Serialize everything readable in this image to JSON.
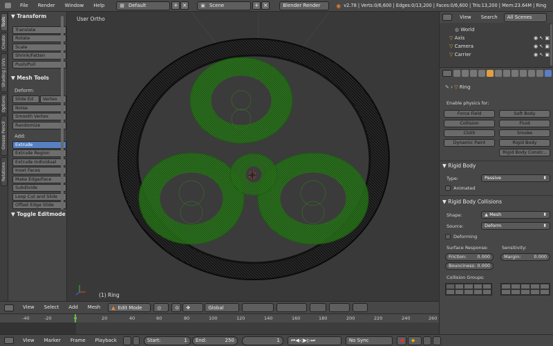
{
  "topbar": {
    "menus": [
      "File",
      "Render",
      "Window",
      "Help"
    ],
    "layout": "Default",
    "scene": "Scene",
    "engine": "Blender Render",
    "stats": "v2.78 | Verts:0/6,600 | Edges:0/13,200 | Faces:0/6,600 | Tris:13,200 | Mem:23.64M | Ring"
  },
  "tabs": [
    "Tools",
    "Create",
    "Shading / UVs",
    "Options",
    "Grease Pencil",
    "Relations"
  ],
  "shelf": {
    "transform_header": "Transform",
    "transform": [
      "Translate",
      "Rotate",
      "Scale",
      "Shrink/Fatten",
      "Push/Pull"
    ],
    "mesh_tools_header": "Mesh Tools",
    "deform_label": "Deform:",
    "slide_edge": "Slide Ed",
    "vertex": "Vertex",
    "deform": [
      "Noise",
      "Smooth Vertex",
      "Randomize"
    ],
    "add_label": "Add:",
    "add": [
      "Extrude",
      "Extrude Region",
      "Extrude Individual",
      "Inset Faces",
      "Make Edge/Face",
      "Subdivide",
      "Loop Cut and Slide",
      "Offset Edge Slide"
    ],
    "toggle_header": "Toggle Editmode"
  },
  "viewport": {
    "title": "User Ortho",
    "object": "(1) Ring"
  },
  "vpheader": {
    "menus": [
      "View",
      "Select",
      "Add",
      "Mesh"
    ],
    "mode": "Edit Mode",
    "orientation": "Global"
  },
  "timeline": {
    "ticks": [
      "-40",
      "-20",
      "0",
      "20",
      "40",
      "60",
      "80",
      "100",
      "120",
      "140",
      "160",
      "180",
      "200",
      "220",
      "240",
      "260"
    ],
    "menus": [
      "View",
      "Marker",
      "Frame",
      "Playback"
    ],
    "start_label": "Start:",
    "start_value": "1",
    "end_label": "End:",
    "end_value": "250",
    "current": "1",
    "sync": "No Sync"
  },
  "outliner": {
    "menus": [
      "View",
      "Search"
    ],
    "filter": "All Scenes",
    "items": [
      "World",
      "Axis",
      "Camera",
      "Carrier"
    ]
  },
  "properties": {
    "object": "Ring",
    "enable_label": "Enable physics for:",
    "physics": [
      "Force Field",
      "Soft Body",
      "Collision",
      "Fluid",
      "Cloth",
      "Smoke",
      "Dynamic Paint",
      "Rigid Body",
      "Rigid Body Constr..."
    ],
    "rigid_body_header": "Rigid Body",
    "type_label": "Type:",
    "type_value": "Passive",
    "animated_label": "Animated",
    "collisions_header": "Rigid Body Collisions",
    "shape_label": "Shape:",
    "shape_value": "Mesh",
    "source_label": "Source:",
    "source_value": "Deform",
    "deforming_label": "Deforming",
    "surface_label": "Surface Response:",
    "sensitivity_label": "Sensitivity:",
    "friction_label": "Friction:",
    "friction_value": "0.000",
    "margin_label": "Margin:",
    "margin_value": "0.000",
    "bounciness_label": "Bounciness:",
    "bounciness_value": "0.000",
    "groups_label": "Collision Groups:"
  },
  "colors": {
    "accent": "#5680c2",
    "gear_green": "#2e7d1e",
    "ring_black": "#111111"
  }
}
